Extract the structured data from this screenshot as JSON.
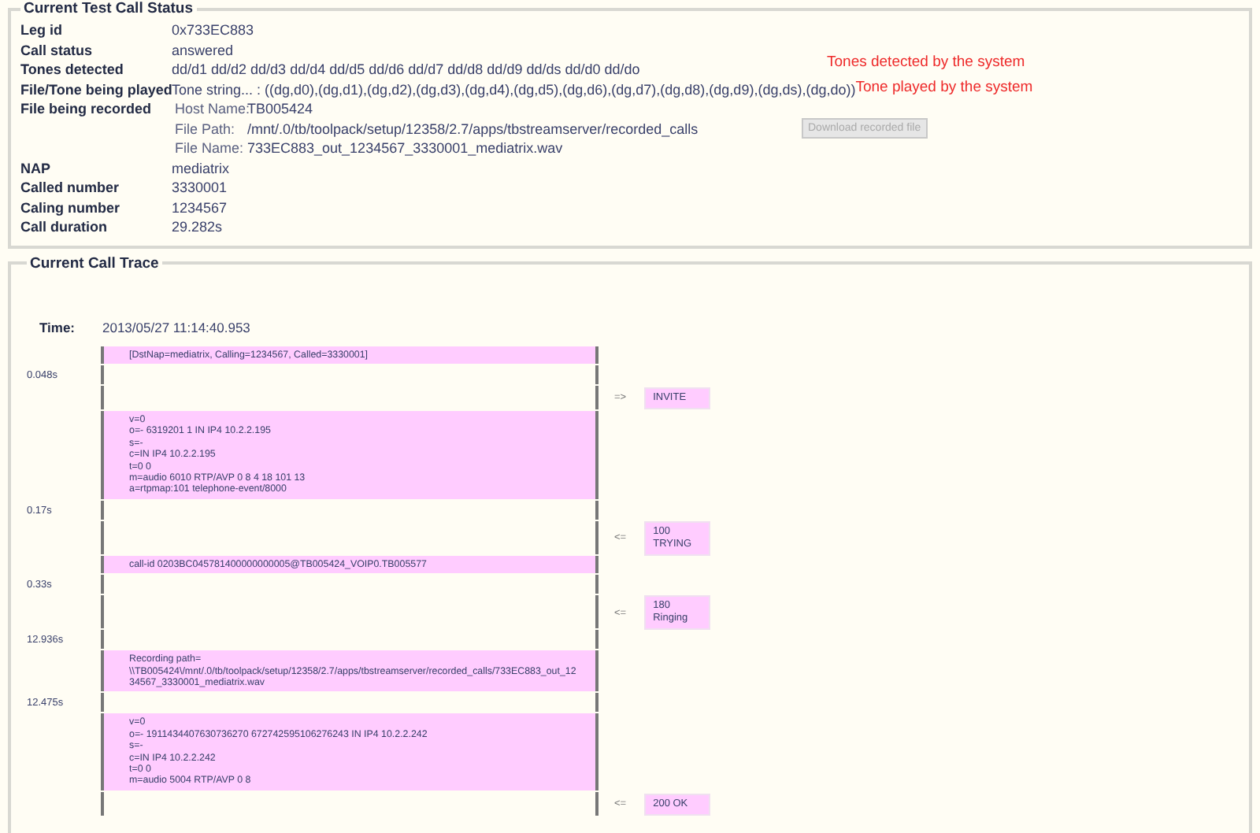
{
  "status": {
    "title": "Current Test Call Status",
    "fields": [
      {
        "kind": "text",
        "label": "Leg id",
        "value": "0x733EC883"
      },
      {
        "kind": "text",
        "label": "Call status",
        "value": "answered"
      },
      {
        "kind": "text",
        "label": "Tones detected",
        "value": "dd/d1 dd/d2 dd/d3 dd/d4 dd/d5 dd/d6 dd/d7 dd/d8 dd/d9 dd/ds dd/d0 dd/do",
        "note": "Tones detected by the system"
      },
      {
        "kind": "text",
        "label": "File/Tone being played",
        "value": "Tone string... : ((dg,d0),(dg,d1),(dg,d2),(dg,d3),(dg,d4),(dg,d5),(dg,d6),(dg,d7),(dg,d8),(dg,d9),(dg,ds),(dg,do))",
        "note": "Tone played by the system"
      },
      {
        "kind": "file",
        "label": "File being recorded",
        "parts": [
          {
            "label": "Host Name:",
            "value": "TB005424"
          },
          {
            "label": "File Path:",
            "value": "/mnt/.0/tb/toolpack/setup/12358/2.7/apps/tbstreamserver/recorded_calls"
          },
          {
            "label": "File Name:",
            "value": "733EC883_out_1234567_3330001_mediatrix.wav"
          }
        ],
        "button": {
          "label": "Download recorded file",
          "disabled": true
        }
      },
      {
        "kind": "text",
        "label": "NAP",
        "value": "mediatrix"
      },
      {
        "kind": "text",
        "label": "Called number",
        "value": "3330001"
      },
      {
        "kind": "text",
        "label": "Caling number",
        "value": "1234567"
      },
      {
        "kind": "text",
        "label": "Call duration",
        "value": "29.282s"
      }
    ]
  },
  "trace": {
    "title": "Current Call Trace",
    "time_label": "Time:",
    "time_value": "2013/05/27 11:14:40.953",
    "rows": [
      {
        "kind": "message",
        "lines": [
          "[DstNap=mediatrix, Calling=1234567, Called=3330001]"
        ]
      },
      {
        "kind": "gap",
        "time": "0.048s"
      },
      {
        "kind": "signal",
        "arrow": "=>",
        "label": "INVITE"
      },
      {
        "kind": "message",
        "lines": [
          "v=0",
          "o=- 6319201 1 IN IP4 10.2.2.195",
          "s=-",
          "c=IN IP4 10.2.2.195",
          "t=0 0",
          "m=audio 6010 RTP/AVP 0 8 4 18 101 13",
          "a=rtpmap:101 telephone-event/8000"
        ]
      },
      {
        "kind": "gap",
        "time": "0.17s"
      },
      {
        "kind": "signal",
        "arrow": "<=",
        "label": "100 TRYING"
      },
      {
        "kind": "message",
        "lines": [
          "call-id 0203BC045781400000000005@TB005424_VOIP0.TB005577"
        ]
      },
      {
        "kind": "gap",
        "time": "0.33s"
      },
      {
        "kind": "signal",
        "arrow": "<=",
        "label": "180 Ringing"
      },
      {
        "kind": "gap",
        "time": "12.936s"
      },
      {
        "kind": "message",
        "lines": [
          "Recording path=",
          "\\\\TB005424\\/mnt/.0/tb/toolpack/setup/12358/2.7/apps/tbstreamserver/recorded_calls/733EC883_out_12",
          "34567_3330001_mediatrix.wav"
        ]
      },
      {
        "kind": "gap",
        "time": "12.475s"
      },
      {
        "kind": "message",
        "lines": [
          "v=0",
          "o=- 1911434407630736270 672742595106276243 IN IP4 10.2.2.242",
          "s=-",
          "c=IN IP4 10.2.2.242",
          "t=0 0",
          "m=audio 5004 RTP/AVP 0 8"
        ]
      },
      {
        "kind": "signal",
        "arrow": "<=",
        "label": "200 OK"
      }
    ]
  }
}
